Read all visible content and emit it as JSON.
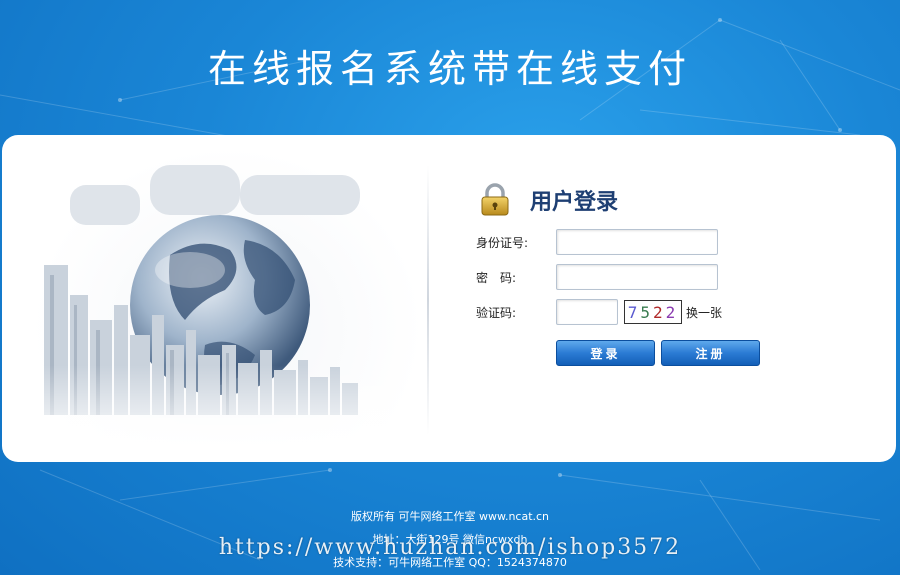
{
  "header": {
    "title": "在线报名系统带在线支付"
  },
  "login": {
    "title": "用户登录",
    "id_label": "身份证号:",
    "id_value": "",
    "password_label": "密　码:",
    "password_value": "",
    "captcha_label": "验证码:",
    "captcha_value": "",
    "captcha_chars": [
      "7",
      "5",
      "2",
      "2"
    ],
    "refresh_label": "换一张",
    "login_button": "登录",
    "register_button": "注册"
  },
  "footer": {
    "copyright": "版权所有 可牛网络工作室 www.ncat.cn",
    "address": "地址：大街129号 微信ncwxdh",
    "support": "技术支持：可牛网络工作室 QQ：1524374870"
  },
  "watermark": "https://www.huzhan.com/ishop3572",
  "colors": {
    "background": "#1a86d6",
    "button": "#2b7bd4",
    "title_text": "#1e3f73"
  }
}
